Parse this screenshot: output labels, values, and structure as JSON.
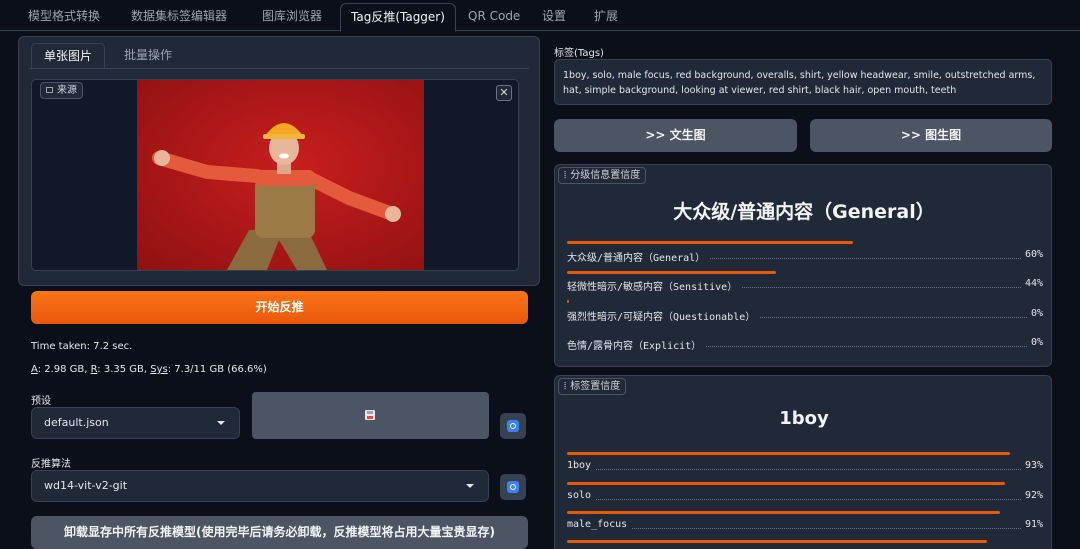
{
  "tabs": [
    {
      "label": "模型格式转换"
    },
    {
      "label": "数据集标签编辑器"
    },
    {
      "label": "图库浏览器"
    },
    {
      "label": "Tag反推(Tagger)"
    },
    {
      "label": "QR Code"
    },
    {
      "label": "设置"
    },
    {
      "label": "扩展"
    }
  ],
  "left": {
    "subtabs": [
      "单张图片",
      "批量操作"
    ],
    "source_label": "来源",
    "run_button": "开始反推",
    "time_taken": "Time taken: 7.2 sec.",
    "memory_parts": {
      "a_key": "A",
      "a_val": ": 2.98 GB, ",
      "r_key": "R",
      "r_val": ": 3.35 GB, ",
      "sys_key": "Sys",
      "sys_val": ": 7.3/11 GB (66.6%)"
    },
    "preset_label": "预设",
    "preset_value": "default.json",
    "algo_label": "反推算法",
    "algo_value": "wd14-vit-v2-git",
    "unload_button": "卸载显存中所有反推模型(使用完毕后请务必卸载，反推模型将占用大量宝贵显存)"
  },
  "right": {
    "tags_label": "标签(Tags)",
    "tags_text": "1boy, solo, male focus, red background, overalls, shirt, yellow headwear, smile, outstretched arms, hat, simple background, looking at viewer, red shirt, black hair, open mouth, teeth",
    "txt2img_button": ">> 文生图",
    "img2img_button": ">> 图生图",
    "rating_label": "分级信息置信度",
    "rating_title": "大众级/普通内容（General）",
    "ratings": [
      {
        "name": "大众级/普通内容（General）",
        "pct": "60%",
        "value": 0.6
      },
      {
        "name": "轻微性暗示/敏感内容（Sensitive）",
        "pct": "44%",
        "value": 0.44
      },
      {
        "name": "强烈性暗示/可疑内容（Questionable）",
        "pct": "0%",
        "value": 0.005
      },
      {
        "name": "色情/露骨内容（Explicit）",
        "pct": "0%",
        "value": 0.0
      }
    ],
    "tag_conf_label": "标签置信度",
    "tag_conf_title": "1boy",
    "tag_confs": [
      {
        "name": "1boy",
        "pct": "93%",
        "value": 0.93
      },
      {
        "name": "solo",
        "pct": "92%",
        "value": 0.92
      },
      {
        "name": "male_focus",
        "pct": "91%",
        "value": 0.91
      }
    ]
  },
  "colors": {
    "accent": "#ea580c",
    "background": "#0b0f19",
    "panel": "#1f2937",
    "photo_bg": "#b91c1c"
  }
}
